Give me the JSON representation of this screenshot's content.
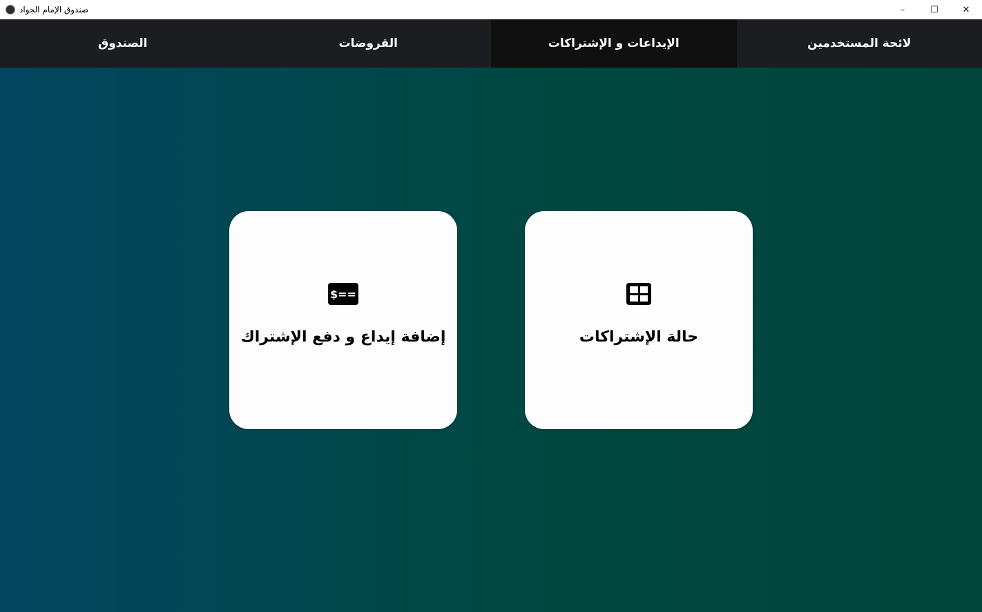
{
  "window": {
    "title": "صندوق الإمام الجواد",
    "minimize": "–",
    "maximize": "☐",
    "close": "✕"
  },
  "nav": {
    "tabs": [
      {
        "label": "لائحة المستخدمين"
      },
      {
        "label": "الإيداعات و الإشتراكات",
        "active": true
      },
      {
        "label": "القروضات"
      },
      {
        "label": "الصندوق"
      }
    ]
  },
  "cards": [
    {
      "label": "حالة الإشتراكات",
      "icon": "table-icon"
    },
    {
      "label": "إضافة إيداع و دفع الإشتراك",
      "icon": "money-bill-icon",
      "icon_text": "$=="
    }
  ]
}
